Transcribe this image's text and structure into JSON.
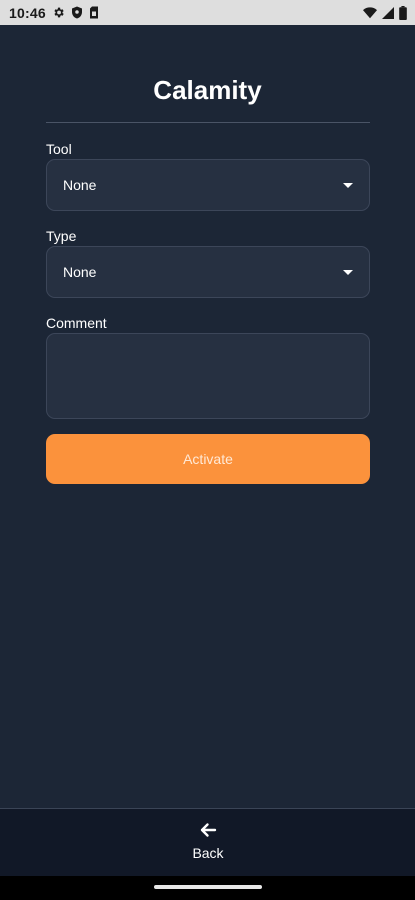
{
  "status_bar": {
    "time": "10:46",
    "icons_left": [
      "gear-icon",
      "shield-icon",
      "sim-card-icon"
    ],
    "icons_right": [
      "wifi-icon",
      "signal-icon",
      "battery-icon"
    ]
  },
  "page": {
    "title": "Calamity"
  },
  "form": {
    "tool": {
      "label": "Tool",
      "value": "None"
    },
    "type": {
      "label": "Type",
      "value": "None"
    },
    "comment": {
      "label": "Comment",
      "value": ""
    },
    "activate_label": "Activate"
  },
  "bottom_nav": {
    "back_label": "Back",
    "back_icon": "arrow-left-icon"
  },
  "colors": {
    "background": "#1c2636",
    "field_background": "#263041",
    "accent": "#fb923c",
    "bottom_bar": "#111827"
  }
}
